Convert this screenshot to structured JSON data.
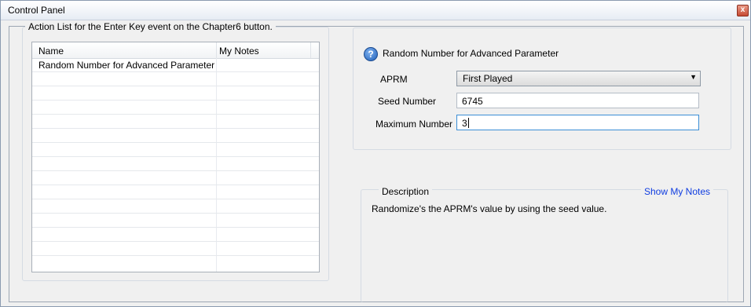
{
  "window": {
    "title": "Control Panel",
    "close_glyph": "x"
  },
  "action_list": {
    "legend": "Action List for the Enter Key event on the Chapter6 button.",
    "columns": [
      "Name",
      "My Notes"
    ],
    "rows": [
      {
        "name": "Random Number for Advanced Parameter",
        "notes": ""
      },
      {
        "name": "",
        "notes": ""
      },
      {
        "name": "",
        "notes": ""
      },
      {
        "name": "",
        "notes": ""
      },
      {
        "name": "",
        "notes": ""
      },
      {
        "name": "",
        "notes": ""
      },
      {
        "name": "",
        "notes": ""
      },
      {
        "name": "",
        "notes": ""
      },
      {
        "name": "",
        "notes": ""
      },
      {
        "name": "",
        "notes": ""
      },
      {
        "name": "",
        "notes": ""
      },
      {
        "name": "",
        "notes": ""
      },
      {
        "name": "",
        "notes": ""
      },
      {
        "name": "",
        "notes": ""
      }
    ]
  },
  "parameter": {
    "icon": "help-icon",
    "title": "Random Number for Advanced Parameter",
    "aprm_label": "APRM",
    "aprm_value": "First Played",
    "seed_label": "Seed Number",
    "seed_value": "6745",
    "max_label": "Maximum Number",
    "max_value": "3"
  },
  "description": {
    "legend": "Description",
    "show_notes": "Show My Notes",
    "text": "Randomize's the APRM's value by using the seed value."
  },
  "colors": {
    "link": "#0f3ce0",
    "close": "#c64a33",
    "focus": "#3b8ed6"
  }
}
